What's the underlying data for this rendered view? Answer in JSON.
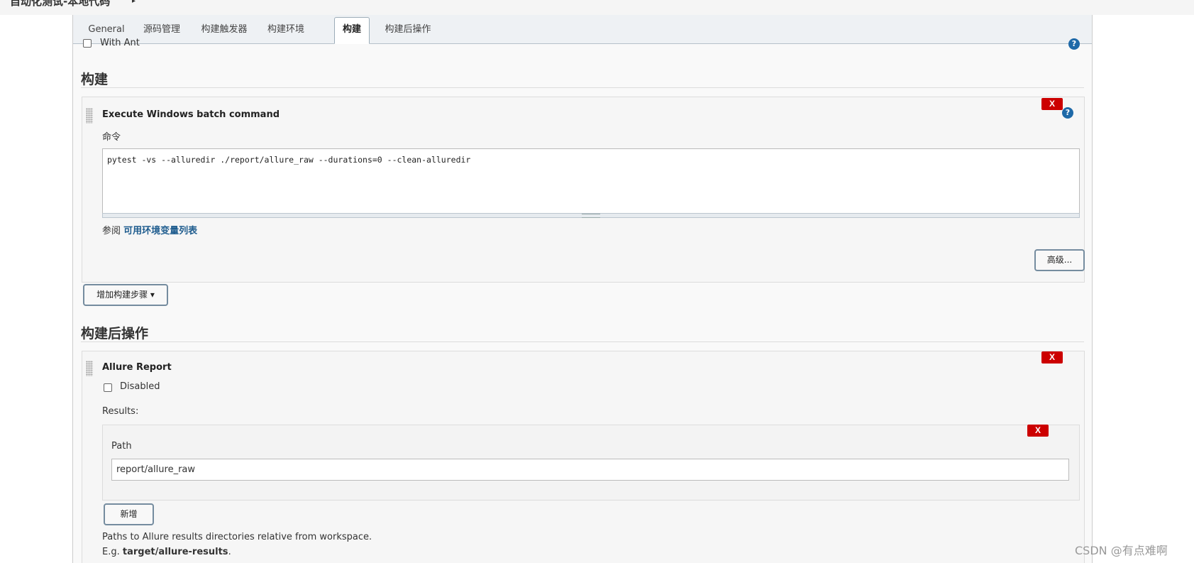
{
  "breadcrumb": {
    "job_name": "自动化测试-本地代码",
    "arrow": "▸"
  },
  "tabs": [
    {
      "label": "General"
    },
    {
      "label": "源码管理"
    },
    {
      "label": "构建触发器"
    },
    {
      "label": "构建环境"
    },
    {
      "label": "构建"
    },
    {
      "label": "构建后操作"
    }
  ],
  "active_tab": "构建",
  "cut_off_option": {
    "label": "With Ant"
  },
  "build_section": {
    "title": "构建",
    "step": {
      "title": "Execute Windows batch command",
      "command_label": "命令",
      "command_value": "pytest -vs --alluredir ./report/allure_raw --durations=0 --clean-alluredir",
      "env_prefix": "参阅",
      "env_link": "可用环境变量列表",
      "advanced_button": "高级..."
    },
    "add_step_button": "增加构建步骤",
    "dropdown_caret": "▾"
  },
  "post_build_section": {
    "title": "构建后操作",
    "step": {
      "title": "Allure Report",
      "disabled_label": "Disabled",
      "results_label": "Results:",
      "path_label": "Path",
      "path_value": "report/allure_raw",
      "add_button": "新增",
      "help_line1": "Paths to Allure results directories relative from workspace.",
      "help_line2_prefix": "E.g.",
      "help_line2_example": "target/allure-results",
      "help_line2_suffix": "."
    }
  },
  "delete_label": "X",
  "help_glyph": "?",
  "watermark": "CSDN @有点难啊",
  "colors": {
    "delete_red": "#cc0000",
    "help_blue": "#1e69a8",
    "link_blue": "#1e5c8e",
    "tab_bar": "#eef1f4"
  }
}
